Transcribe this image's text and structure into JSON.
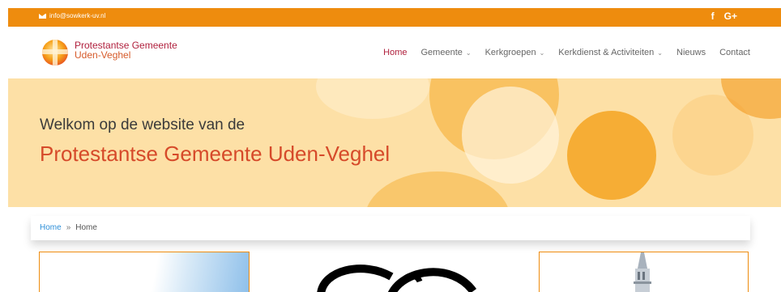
{
  "topbar": {
    "email": "info@sowkerk-uv.nl",
    "social": [
      "f",
      "G+"
    ],
    "color": "#ee8c0e"
  },
  "brand": {
    "line1": "Protestantse Gemeente",
    "line2": "Uden-Veghel"
  },
  "nav": {
    "items": [
      {
        "label": "Home",
        "dropdown": false,
        "active": true
      },
      {
        "label": "Gemeente",
        "dropdown": true,
        "active": false
      },
      {
        "label": "Kerkgroepen",
        "dropdown": true,
        "active": false
      },
      {
        "label": "Kerkdienst & Activiteiten",
        "dropdown": true,
        "active": false
      },
      {
        "label": "Nieuws",
        "dropdown": false,
        "active": false
      },
      {
        "label": "Contact",
        "dropdown": false,
        "active": false
      }
    ],
    "active_color": "#b0203d"
  },
  "hero": {
    "subtitle": "Welkom op de website van de",
    "title": "Protestantse Gemeente Uden-Veghel",
    "title_color": "#d64a2a"
  },
  "breadcrumb": {
    "home_link": "Home",
    "separator": "»",
    "current": "Home"
  },
  "icons": {
    "mail": "mail-icon",
    "facebook": "facebook-icon",
    "google_plus": "google-plus-icon",
    "logo": "church-logo-icon",
    "chevron": "chevron-down-icon"
  }
}
